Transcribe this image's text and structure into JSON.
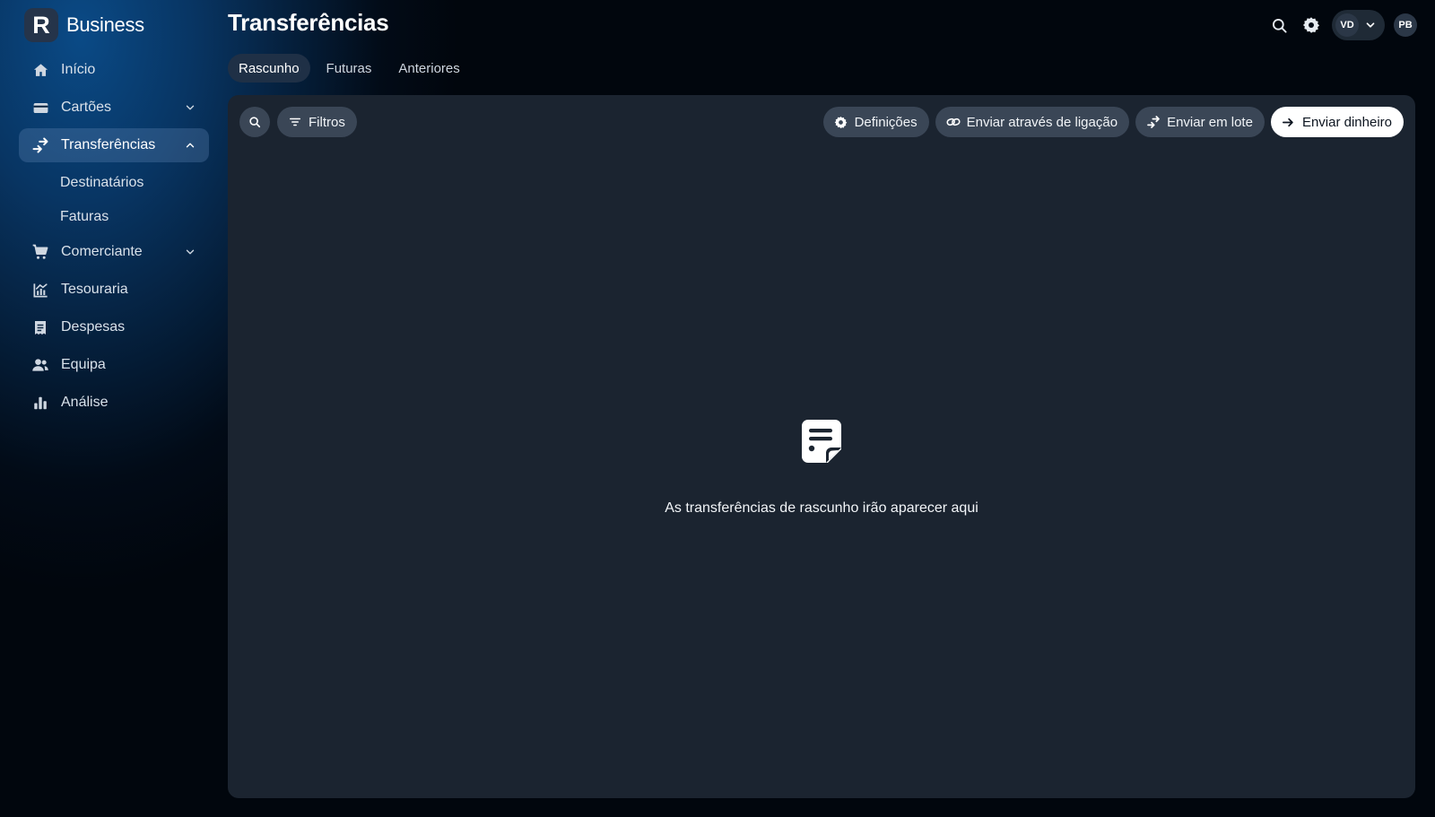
{
  "brand": {
    "logo_letter": "R",
    "name": "Business"
  },
  "page": {
    "title": "Transferências"
  },
  "sidebar": {
    "items": [
      {
        "label": "Início",
        "icon": "home-icon"
      },
      {
        "label": "Cartões",
        "icon": "card-icon",
        "expandable": true
      },
      {
        "label": "Transferências",
        "icon": "transfer-icon",
        "expandable": true,
        "expanded": true,
        "active": true,
        "children": [
          {
            "label": "Destinatários"
          },
          {
            "label": "Faturas"
          }
        ]
      },
      {
        "label": "Comerciante",
        "icon": "cart-icon",
        "expandable": true
      },
      {
        "label": "Tesouraria",
        "icon": "chart-line-icon"
      },
      {
        "label": "Despesas",
        "icon": "receipt-icon"
      },
      {
        "label": "Equipa",
        "icon": "team-icon"
      },
      {
        "label": "Análise",
        "icon": "bar-chart-icon"
      }
    ]
  },
  "header": {
    "account_initials": "VD",
    "profile_initials": "PB",
    "icons": [
      "search-icon",
      "gear-icon",
      "chevron-down-icon"
    ]
  },
  "tabs": [
    {
      "label": "Rascunho",
      "active": true
    },
    {
      "label": "Futuras",
      "active": false
    },
    {
      "label": "Anteriores",
      "active": false
    }
  ],
  "toolbar": {
    "filters_label": "Filtros",
    "settings_label": "Definições",
    "send_link_label": "Enviar através de ligação",
    "bulk_label": "Enviar em lote",
    "send_money_label": "Enviar dinheiro"
  },
  "empty_state": {
    "icon": "draft-document-icon",
    "message": "As transferências de rascunho irão aparecer aqui"
  },
  "colors": {
    "panel_bg": "#1b2430",
    "pill_bg": "#3a4656",
    "primary_btn_bg": "#ffffff",
    "active_nav_bg": "#3a5878"
  }
}
